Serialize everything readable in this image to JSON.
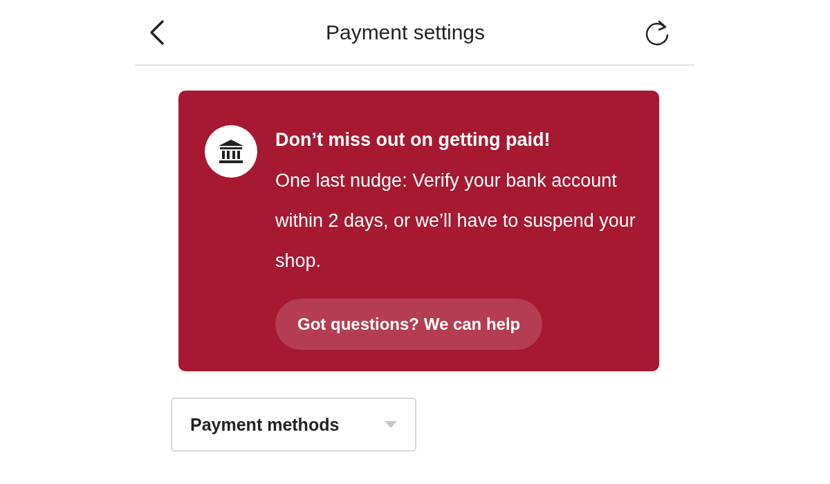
{
  "header": {
    "title": "Payment settings"
  },
  "banner": {
    "title": "Don’t miss out on getting paid!",
    "message": "One last nudge: Verify your bank account within 2 days, or we’ll have to suspend your shop.",
    "button": "Got questions? We can help"
  },
  "dropdown": {
    "label": "Payment methods"
  }
}
